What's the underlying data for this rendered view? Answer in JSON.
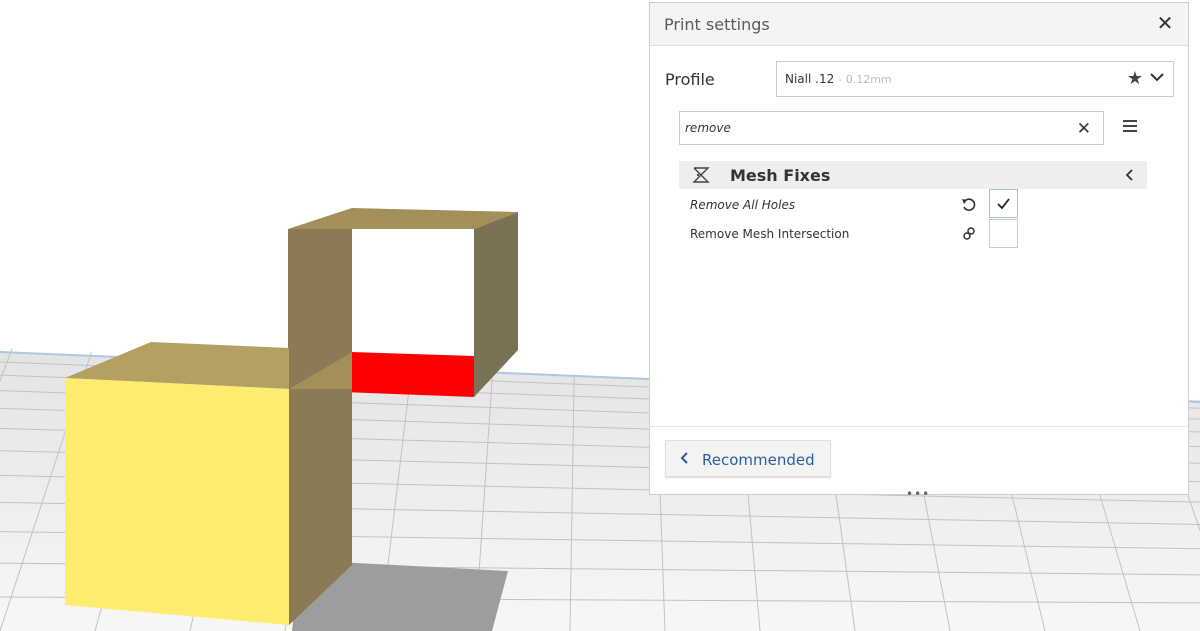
{
  "panel": {
    "title": "Print settings",
    "close_icon": "close-icon",
    "profile": {
      "label": "Profile",
      "name": "Niall .12",
      "sub": "- 0.12mm",
      "icons": [
        "star-icon",
        "chevron-down-icon"
      ]
    },
    "search": {
      "value": "remove",
      "icons": [
        "clear-search-icon",
        "settings-menu-icon"
      ]
    },
    "category": {
      "label": "Mesh Fixes",
      "icons": [
        "mesh-fixes-icon",
        "chevron-left-icon"
      ]
    },
    "settings": [
      {
        "label": "Remove All Holes",
        "checked": true,
        "icon": "reset-icon",
        "italic": true
      },
      {
        "label": "Remove Mesh Intersection",
        "checked": false,
        "icon": "link-icon",
        "italic": false
      }
    ],
    "recommended_button": {
      "label": "Recommended",
      "icon": "chevron-left-icon"
    },
    "drag_handle": "•••"
  },
  "scene": {
    "colors": {
      "build_plate": "#f1f1f1",
      "selected_model": "#ffe96a",
      "model": "#a8955a",
      "missing_face": "#ff0000",
      "shadow": "#9a9a9a",
      "accent": "#2c5e9f"
    }
  }
}
